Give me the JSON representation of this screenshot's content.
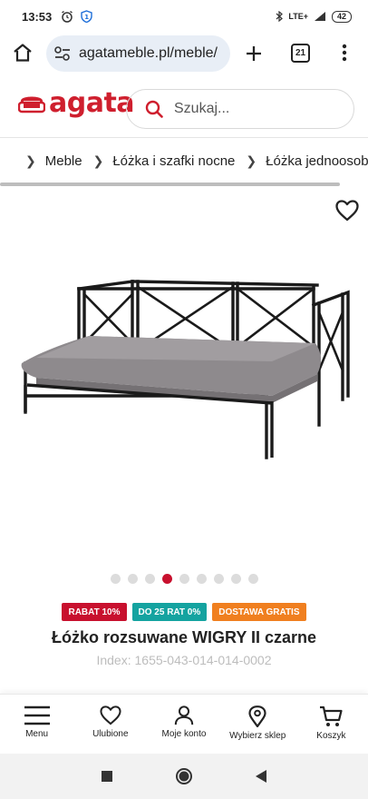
{
  "status_bar": {
    "time": "13:53",
    "network": "LTE+",
    "battery": "42"
  },
  "browser": {
    "url": "agatameble.pl/meble/",
    "tab_count": "21"
  },
  "site": {
    "logo_text": "agata",
    "search_placeholder": "Szukaj...",
    "brand_color": "#cf1f2e"
  },
  "breadcrumb": {
    "items": [
      "Meble",
      "Łóżka i szafki nocne",
      "Łóżka jednoosobowe"
    ]
  },
  "gallery": {
    "image_count": 9,
    "active_index": 3
  },
  "badges": [
    {
      "label": "RABAT 10%",
      "color": "#c8102e"
    },
    {
      "label": "DO 25 RAT 0%",
      "color": "#14a3a0"
    },
    {
      "label": "DOSTAWA GRATIS",
      "color": "#f07f1f"
    }
  ],
  "product": {
    "title": "Łóżko rozsuwane WIGRY II czarne",
    "index": "Index: 1655-043-014-014-0002"
  },
  "bottom_nav": [
    {
      "label": "Menu",
      "icon": "menu-icon"
    },
    {
      "label": "Ulubione",
      "icon": "heart-icon"
    },
    {
      "label": "Moje konto",
      "icon": "user-icon"
    },
    {
      "label": "Wybierz sklep",
      "icon": "location-pin-icon"
    },
    {
      "label": "Koszyk",
      "icon": "cart-icon"
    }
  ]
}
